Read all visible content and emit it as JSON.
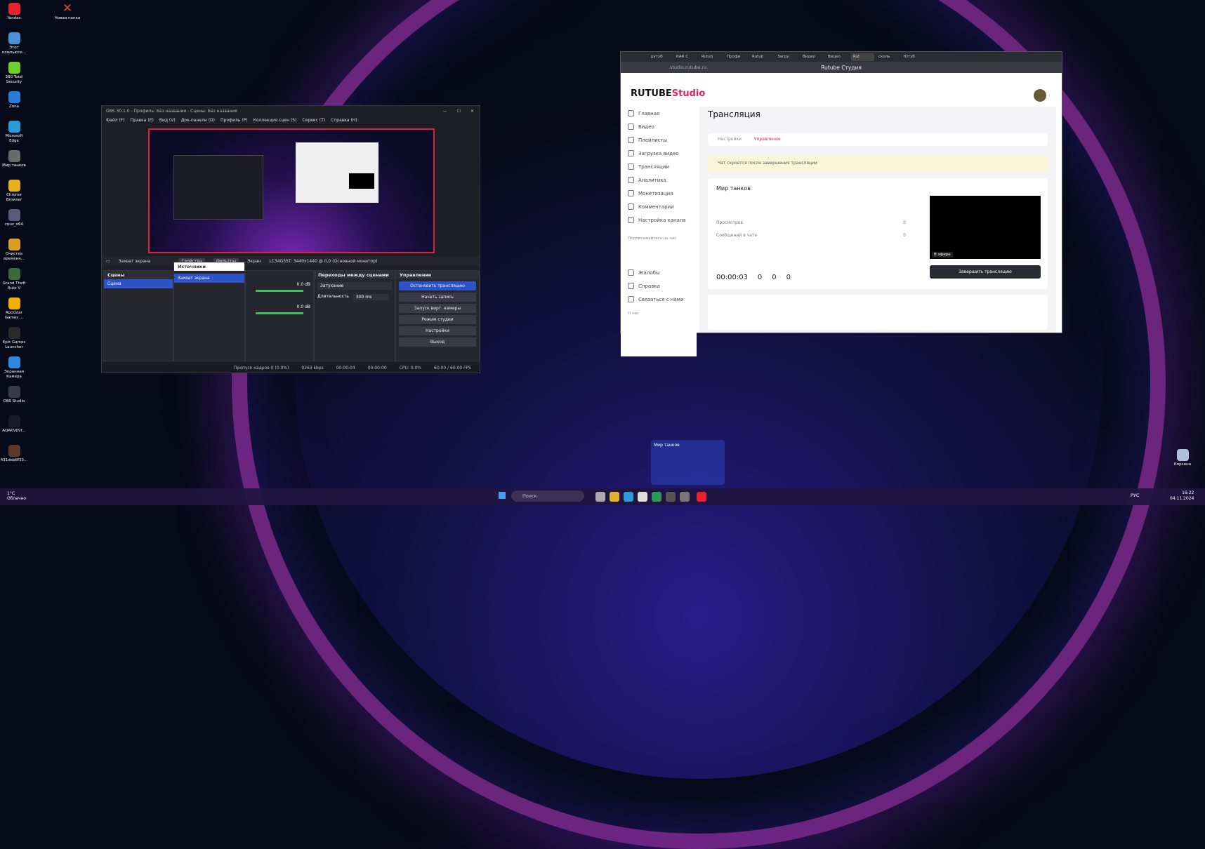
{
  "desktop": {
    "icons": [
      {
        "label": "Yandex",
        "color": "#e8222e"
      },
      {
        "label": "Этот компьюте...",
        "color": "#4a8fd8"
      },
      {
        "label": "360 Total Security",
        "color": "#6fcf2f"
      },
      {
        "label": "Zona",
        "color": "#2a7bd8"
      },
      {
        "label": "Microsoft Edge",
        "color": "#2b9ad8"
      },
      {
        "label": "Мир танков",
        "color": "#6a6a6a"
      },
      {
        "label": "Chrome Browser",
        "color": "#e8b020"
      },
      {
        "label": "cpuz_x64",
        "color": "#5a5a7a"
      },
      {
        "label": "Очистка временн...",
        "color": "#d8a020"
      },
      {
        "label": "Grand Theft Auto V",
        "color": "#3a6a3a"
      },
      {
        "label": "Rockstar Games ...",
        "color": "#f0b000"
      },
      {
        "label": "Epic Games Launcher",
        "color": "#2a2a2a"
      },
      {
        "label": "Экранная Камера",
        "color": "#2a8ae0"
      },
      {
        "label": "OBS Studio",
        "color": "#3a3a4a"
      },
      {
        "label": "AQAKVbVr...",
        "color": "#1a1a2a"
      },
      {
        "label": "431deb8f33...",
        "color": "#5a3a2a"
      }
    ],
    "top_folder": "Новая папка",
    "recycle": "Корзина"
  },
  "obs": {
    "title": "OBS 30.1.0 - Профиль: Без названия - Сцены: Без названия",
    "menu": [
      "Файл (F)",
      "Правка (E)",
      "Вид (V)",
      "Док-панели (D)",
      "Профиль (P)",
      "Коллекция сцен (S)",
      "Сервис (T)",
      "Справка (H)"
    ],
    "source_bar": {
      "name": "Захват экрана",
      "props": "Свойства",
      "filters": "Фильтры",
      "screen_label": "Экран",
      "screen_value": "LC34G55T: 3440x1440 @ 0,0 (Основной монитор)"
    },
    "scenes": {
      "header": "Сцены",
      "items": [
        "Сцена"
      ]
    },
    "sources": {
      "header": "Источники",
      "items": [
        "Захват экрана"
      ]
    },
    "mixer": {
      "db1": "0.0 dB",
      "db2": "0.0 dB"
    },
    "transitions": {
      "header": "Переходы между сценами",
      "type": "Затухание",
      "duration_label": "Длительность",
      "duration": "300 ms"
    },
    "controls": {
      "header": "Управление",
      "buttons": [
        "Остановить трансляцию",
        "Начать запись",
        "Запуск вирт. камеры",
        "Режим студии",
        "Настройки",
        "Выход"
      ]
    },
    "status": {
      "dropped": "Пропуск кадров 0 (0.0%)",
      "bitrate": "9263 kbps",
      "live": "00:00:04",
      "rec": "00:00:00",
      "cpu": "CPU: 0.0%",
      "fps": "60.00 / 60.00 FPS"
    }
  },
  "browser": {
    "tabs": [
      "рутуб",
      "КАК С",
      "Rutub",
      "Профи",
      "Rutub",
      "Загру",
      "Видео",
      "Видео",
      "Rut",
      "сколь",
      "Ютуб"
    ],
    "url": "studio.rutube.ru",
    "page_title": "Rutube Студия",
    "logo": "RUTUBE",
    "logo_suffix": "Studio",
    "nav": [
      "Главная",
      "Видео",
      "Плейлисты",
      "Загрузка видео",
      "Трансляции",
      "Аналитика",
      "Монетизация",
      "Комментарии",
      "Настройка канала"
    ],
    "subscribe_label": "Подписывайтесь на нас",
    "nav2": [
      "Жалобы",
      "Справка",
      "Связаться с нами"
    ],
    "bottom_label": "О нас",
    "heading": "Трансляция",
    "subtabs": [
      "Настройки",
      "Управление"
    ],
    "notice": "Чат скроется после завершения трансляции",
    "stream_name": "Мир танков",
    "stats": [
      {
        "label": "Просмотров",
        "value": "0"
      },
      {
        "label": "Сообщений в чате",
        "value": "0"
      }
    ],
    "live_badge": "В эфире",
    "timer": "00:00:03",
    "viewers": "0",
    "likes": "0",
    "comments": "0",
    "end_button": "Завершить трансляцию"
  },
  "taskbar": {
    "weather_temp": "1°C",
    "weather_text": "Облачно",
    "search": "Поиск",
    "lang": "РУС",
    "time": "16:22",
    "date": "04.11.2024",
    "preview_title": "Мир танков"
  }
}
